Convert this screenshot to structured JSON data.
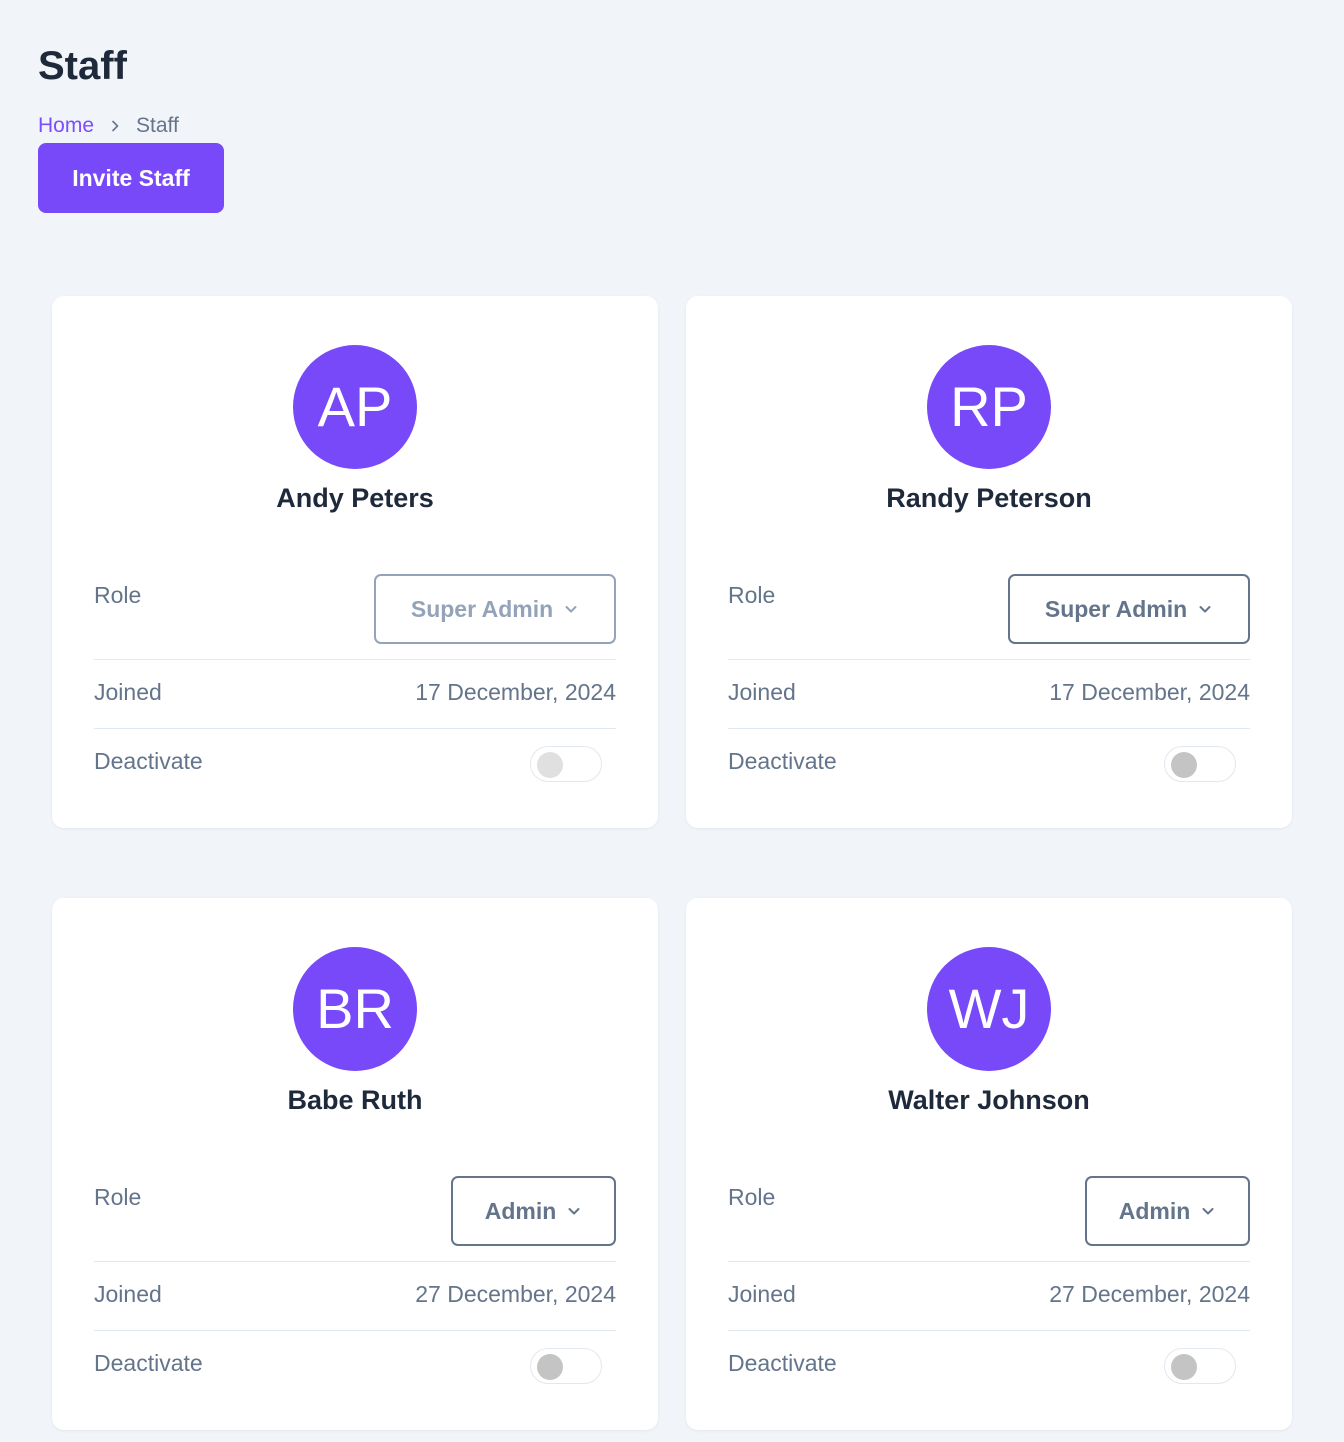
{
  "header": {
    "title": "Staff",
    "breadcrumb": {
      "home": "Home",
      "current": "Staff"
    },
    "invite_label": "Invite Staff"
  },
  "labels": {
    "role": "Role",
    "joined": "Joined",
    "deactivate": "Deactivate"
  },
  "colors": {
    "accent": "#7749f8",
    "background": "#f1f5f9",
    "text_muted": "#64748b"
  },
  "staff": [
    {
      "initials": "AP",
      "name": "Andy Peters",
      "role": "Super Admin",
      "joined": "17 December, 2024",
      "deactivated": false,
      "role_disabled": true
    },
    {
      "initials": "RP",
      "name": "Randy Peterson",
      "role": "Super Admin",
      "joined": "17 December, 2024",
      "deactivated": false,
      "role_disabled": false
    },
    {
      "initials": "BR",
      "name": "Babe Ruth",
      "role": "Admin",
      "joined": "27 December, 2024",
      "deactivated": false,
      "role_disabled": false
    },
    {
      "initials": "WJ",
      "name": "Walter Johnson",
      "role": "Admin",
      "joined": "27 December, 2024",
      "deactivated": false,
      "role_disabled": false
    }
  ]
}
